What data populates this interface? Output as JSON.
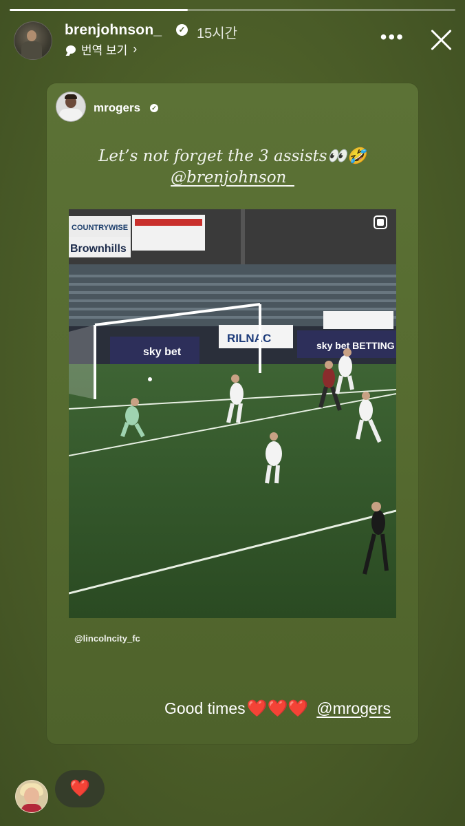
{
  "story": {
    "progress": 0.4,
    "username": "brenjohnson_",
    "time_ago": "15시간",
    "translate_label": "번역 보기",
    "icons": {
      "verified": "verified-badge-icon",
      "more": "more-dots-icon",
      "close": "close-icon"
    }
  },
  "shared_post": {
    "username": "mrogers",
    "caption_line1": "Let’s not forget the 3 assists👀🤣",
    "caption_line2": "@brenjohnson_",
    "video_watermark": "@lincolncity_fc",
    "video_ads": [
      "COUNTRYWISE",
      "Brownhills",
      "sky bet",
      "RILNAC",
      "sky bet BETTING"
    ],
    "overlay_text": "Good times",
    "overlay_hearts": "❤️❤️❤️",
    "overlay_mention": "@mrogers"
  },
  "reaction": {
    "emoji": "❤️"
  },
  "colors": {
    "background": "#4b5d28",
    "card": "#566b30",
    "heart": "#e0312c"
  }
}
